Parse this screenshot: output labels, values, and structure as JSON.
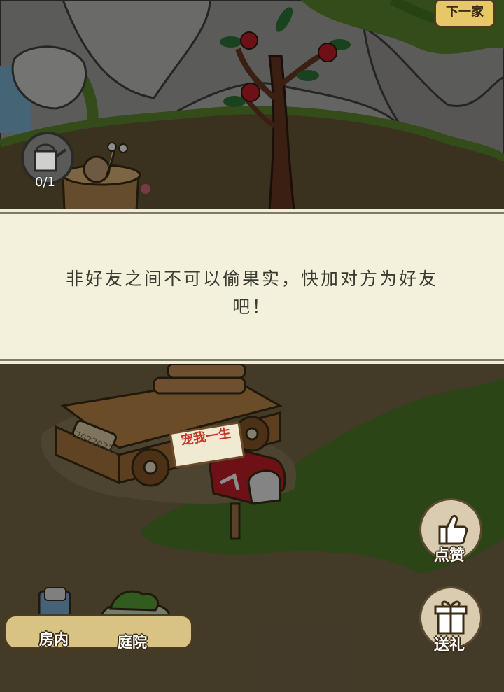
{
  "header": {
    "next_home_label": "下一家"
  },
  "garden": {
    "watering_count": "0/1"
  },
  "dialog": {
    "message": "非好友之间不可以偷果实，快加对方为好友吧！"
  },
  "car": {
    "plate_text": "20220322",
    "sign_text": "宠我一生"
  },
  "actions": {
    "like_label": "点赞",
    "gift_label": "送礼"
  },
  "bottom_tabs": {
    "room_label": "房内",
    "yard_label": "庭院"
  },
  "colors": {
    "dialog_bg": "#f3f1dc",
    "dialog_text": "#3a3a30",
    "button_gold": "#e6c869"
  },
  "icons": [
    "watering-can-icon",
    "thumbs-up-icon",
    "gift-icon",
    "room-icon",
    "yard-icon",
    "mailbox-icon"
  ]
}
